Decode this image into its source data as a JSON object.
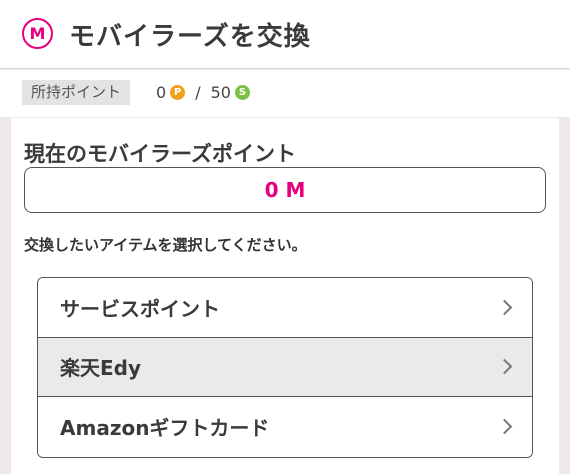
{
  "header": {
    "icon_letter": "M",
    "title": "モバイラーズを交換"
  },
  "points": {
    "label": "所持ポイント",
    "p_value": "0",
    "p_coin_letter": "P",
    "separator": "/",
    "s_value": "50",
    "s_coin_letter": "S"
  },
  "main": {
    "section_title": "現在のモバイラーズポイント",
    "balance": "0 M",
    "instruction": "交換したいアイテムを選択してください。",
    "items": [
      {
        "label": "サービスポイント"
      },
      {
        "label": "楽天Edy"
      },
      {
        "label": "Amazonギフトカード"
      }
    ]
  },
  "colors": {
    "brand": "#e6007e",
    "p_coin": "#f2a01c",
    "s_coin": "#7bc043"
  }
}
